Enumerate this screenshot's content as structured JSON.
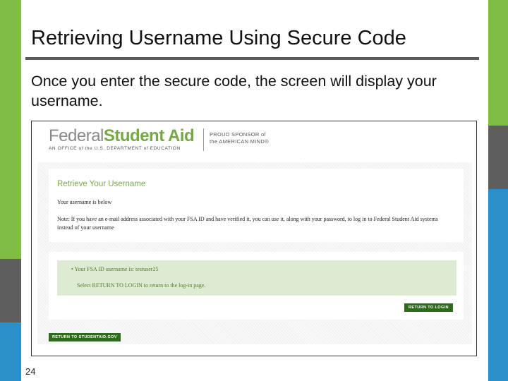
{
  "slide": {
    "title": "Retrieving Username Using Secure Code",
    "body": "Once you enter the secure code, the screen will display your username.",
    "page_number": "24",
    "colors": {
      "bar_green": "#7fbd45",
      "bar_gray": "#5e5e5e",
      "bar_blue": "#2b8fc8"
    }
  },
  "fsa": {
    "logo": {
      "federal": "Federal",
      "student_aid": "Student Aid",
      "tagline": "AN OFFICE of the U.S. DEPARTMENT of EDUCATION"
    },
    "sponsor": {
      "line1": "PROUD SPONSOR of",
      "line2": "the AMERICAN MIND®"
    },
    "retrieve": {
      "heading": "Retrieve Your Username",
      "line1": "Your username is below",
      "note": "Note: If you have an e-mail address associated with your FSA ID and have verified it, you can use it, along with your password, to log in to Federal Student Aid systems instead of your username"
    },
    "success": {
      "line1": "• Your FSA ID username is: testuser25",
      "line2": "Select RETURN TO LOGIN to return to the log-in page."
    },
    "buttons": {
      "return_login": "RETURN TO LOGIN",
      "return_studentaid": "RETURN TO STUDENTAID.GOV"
    },
    "colors": {
      "accent_green": "#75a947",
      "button_green": "#2f6b1d",
      "success_bg": "#dcebd2"
    }
  }
}
